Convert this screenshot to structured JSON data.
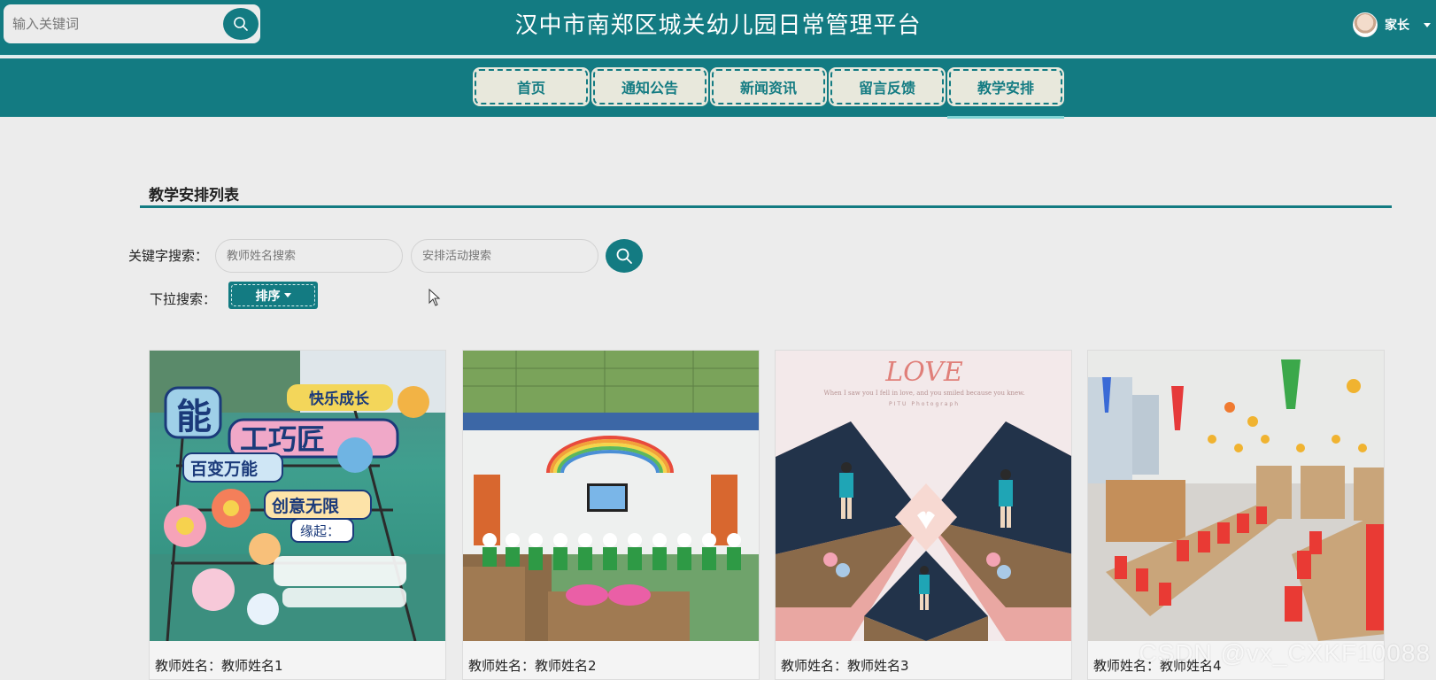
{
  "header": {
    "search_placeholder": "输入关键词",
    "site_title": "汉中市南郑区城关幼儿园日常管理平台",
    "user_label": "家长"
  },
  "nav": {
    "items": [
      {
        "label": "首页"
      },
      {
        "label": "通知公告"
      },
      {
        "label": "新闻资讯"
      },
      {
        "label": "留言反馈"
      },
      {
        "label": "教学安排"
      }
    ],
    "active": "教学安排"
  },
  "section": {
    "title": "教学安排列表"
  },
  "filters": {
    "keyword_label": "关键字搜索：",
    "teacher_placeholder": "教师姓名搜索",
    "activity_placeholder": "安排活动搜索",
    "dropdown_label": "下拉搜索：",
    "sort_label": "排序"
  },
  "cards": [
    {
      "caption": "教师姓名：教师姓名1"
    },
    {
      "caption": "教师姓名：教师姓名2"
    },
    {
      "caption": "教师姓名：教师姓名3"
    },
    {
      "caption": "教师姓名：教师姓名4"
    }
  ],
  "photo_text": {
    "card1_lines": [
      "能",
      "工巧匠",
      "快乐成长",
      "百变万能",
      "创意无限",
      "缘起："
    ],
    "card3_title": "LOVE",
    "card3_sub": "When I saw you I fell in love, and you smiled because you knew.",
    "card3_brand": "PITU Photograph"
  },
  "watermark": "CSDN @vx_CXKF10088",
  "colors": {
    "primary": "#137b82",
    "page_bg": "#ececec",
    "nav_item_bg": "#e8e8dc"
  }
}
